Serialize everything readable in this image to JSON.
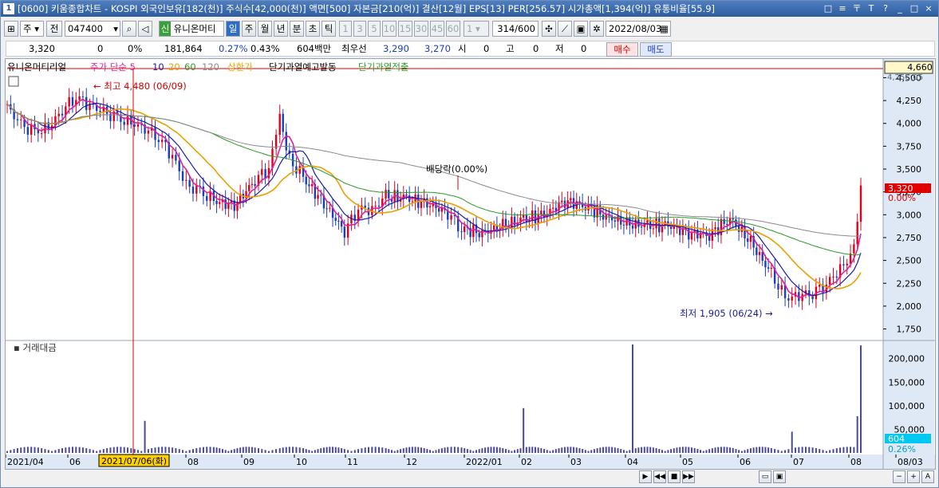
{
  "window": {
    "title": "[0600] 키움종합차트 - KOSPI 외국인보유[182(천)] 주식수[42,000(천)] 액면[500] 자본금[210(억)] 결산[12월] EPS[13] PER[256.57] 시가총액[1,394(억)] 유통비율[55.9]",
    "badge": "1",
    "controls": [
      "□",
      "≡",
      "〒",
      "T",
      "?",
      "_",
      "□",
      "×"
    ]
  },
  "toolbar": {
    "market": "주",
    "market_sep": "전",
    "code": "047400",
    "name": "유니온머티",
    "name_prefix": "신",
    "periods": [
      "일",
      "주",
      "월",
      "년",
      "분",
      "초",
      "틱"
    ],
    "selected_period": "일",
    "minutes": [
      "1",
      "3",
      "5",
      "10",
      "15",
      "30",
      "45",
      "60"
    ],
    "unit": "1",
    "count": "314",
    "count_total": "/600",
    "date": "2022/08/03"
  },
  "quote": {
    "price": "3,320",
    "change": "0",
    "change_pct": "0%",
    "volume": "181,864",
    "rate1": "0.27%",
    "rate2": "0.43%",
    "amount": "604백만",
    "best_label": "최우선",
    "ask": "3,290",
    "bid": "3,270",
    "open_label": "시",
    "open": "0",
    "high_label": "고",
    "high": "0",
    "low_label": "저",
    "low": "0",
    "buy": "매수",
    "sell": "매도"
  },
  "legend": {
    "name": "유니온머티리얼",
    "price_label": "주가 단순 5",
    "ma10": "10",
    "ma20": "20",
    "ma60": "60",
    "ma120": "120",
    "limit": "상한가",
    "signal1": "단기과열예고발동",
    "signal2": "단기과열적출"
  },
  "chart_data": {
    "type": "line",
    "title": "",
    "series": [
      {
        "name": "주가",
        "color": "#000000"
      },
      {
        "name": "5",
        "color": "#e0209a"
      },
      {
        "name": "10",
        "color": "#1a1aa8"
      },
      {
        "name": "20",
        "color": "#e8a000"
      },
      {
        "name": "60",
        "color": "#2a9a2a"
      },
      {
        "name": "120",
        "color": "#8a8a8a"
      }
    ],
    "x_ticks": [
      "2021/04",
      "06",
      "08",
      "09",
      "10",
      "11",
      "12",
      "2022/01",
      "02",
      "03",
      "04",
      "05",
      "06",
      "07",
      "08",
      "08/03"
    ],
    "price_ticks": [
      "4,500",
      "4,250",
      "4,000",
      "3,750",
      "3,500",
      "3,250",
      "3,000",
      "2,750",
      "2,500",
      "2,250",
      "2,000",
      "1,750"
    ],
    "ylim": [
      1650,
      4600
    ],
    "volume_ticks": [
      "200,000",
      "150,000",
      "100,000",
      "50,000"
    ],
    "volume_ylim": [
      0,
      230000
    ],
    "high_marker": "최고 4,480 (06/09)",
    "low_marker": "최저 1,905 (06/24)",
    "dividend_marker": "배당락(0.00%)",
    "cursor_date": "2021/07/06(화)",
    "price_box": "4,660",
    "top_partial": "4,25C,05",
    "last_price": "3,320",
    "last_pct": "0.00%",
    "last_volume": "604",
    "volume_pct": "0.26%",
    "volume_panel": "거래대금"
  }
}
